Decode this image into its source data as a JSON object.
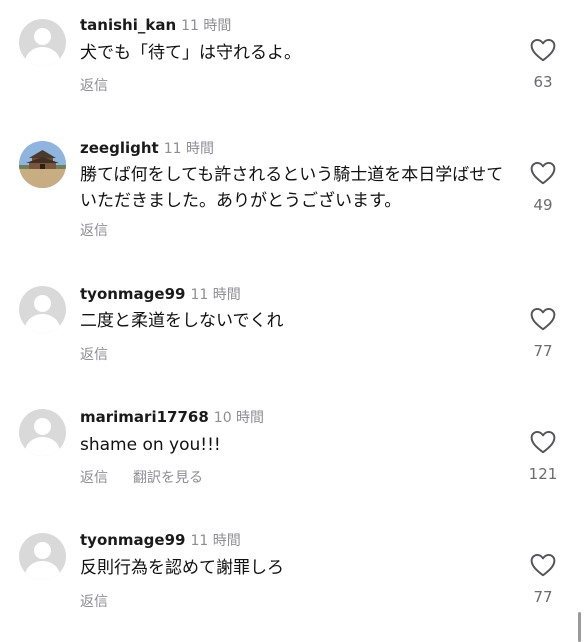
{
  "comments": [
    {
      "username": "tanishi_kan",
      "time": "11 時間",
      "text": "犬でも「待て」は守れるよ。",
      "reply_label": "返信",
      "likes": "63",
      "avatar": "default-avatar-icon"
    },
    {
      "username": "zeeglight",
      "time": "11 時間",
      "text": "勝てば何をしても許されるという騎士道を本日学ばせていただきました。ありがとうございます。",
      "reply_label": "返信",
      "likes": "49",
      "avatar": "temple-photo"
    },
    {
      "username": "tyonmage99",
      "time": "11 時間",
      "text": "二度と柔道をしないでくれ",
      "reply_label": "返信",
      "likes": "77",
      "avatar": "default-avatar-icon"
    },
    {
      "username": "marimari17768",
      "time": "10 時間",
      "text": "shame on you!!!",
      "reply_label": "返信",
      "translate_label": "翻訳を見る",
      "likes": "121",
      "avatar": "default-avatar-icon"
    },
    {
      "username": "tyonmage99",
      "time": "11 時間",
      "text": "反則行為を認めて謝罪しろ",
      "reply_label": "返信",
      "likes": "77",
      "avatar": "default-avatar-icon"
    }
  ],
  "icons": {
    "like": "heart-outline-icon"
  },
  "colors": {
    "text": "#111111",
    "secondary": "#8e8e93",
    "avatar_bg": "#d9d9d9"
  }
}
